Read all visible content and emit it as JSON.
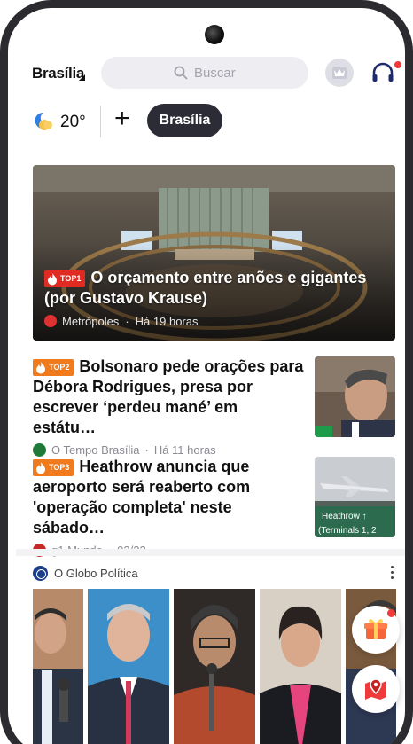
{
  "header": {
    "city": "Brasília",
    "search_placeholder": "Buscar"
  },
  "weather": {
    "temperature": "20°",
    "add_symbol": "+",
    "city_chip": "Brasília"
  },
  "hero": {
    "badge": "TOP1",
    "title": "O orçamento entre anões e gigantes (por Gustavo Krause)",
    "source": "Metrópoles",
    "time": "Há 19 horas"
  },
  "news": [
    {
      "badge": "TOP2",
      "title": "Bolsonaro pede orações para Débora Rodrigues, presa por escrever ‘perdeu mané’ em estátu…",
      "source": "O Tempo Brasília",
      "time": "Há 11 horas"
    },
    {
      "badge": "TOP3",
      "title": "Heathrow anuncia que aeroporto será reaberto com 'operação completa' neste sábado…",
      "source": "g1 Mundo",
      "time": "03/22",
      "thumb_sign": "Heathrow ↑",
      "thumb_sign_sub": "(Terminals 1, 2"
    }
  ],
  "globo": {
    "source": "O Globo Política"
  },
  "colors": {
    "accent_red": "#e02b22",
    "badge_orange": "#f07a1e",
    "chip_dark": "#2c2c37"
  },
  "icons": [
    "search-icon",
    "crown-icon",
    "headset-icon",
    "weather-moon-icon",
    "flame-icon",
    "more-icon",
    "gift-icon",
    "map-pin-icon"
  ]
}
